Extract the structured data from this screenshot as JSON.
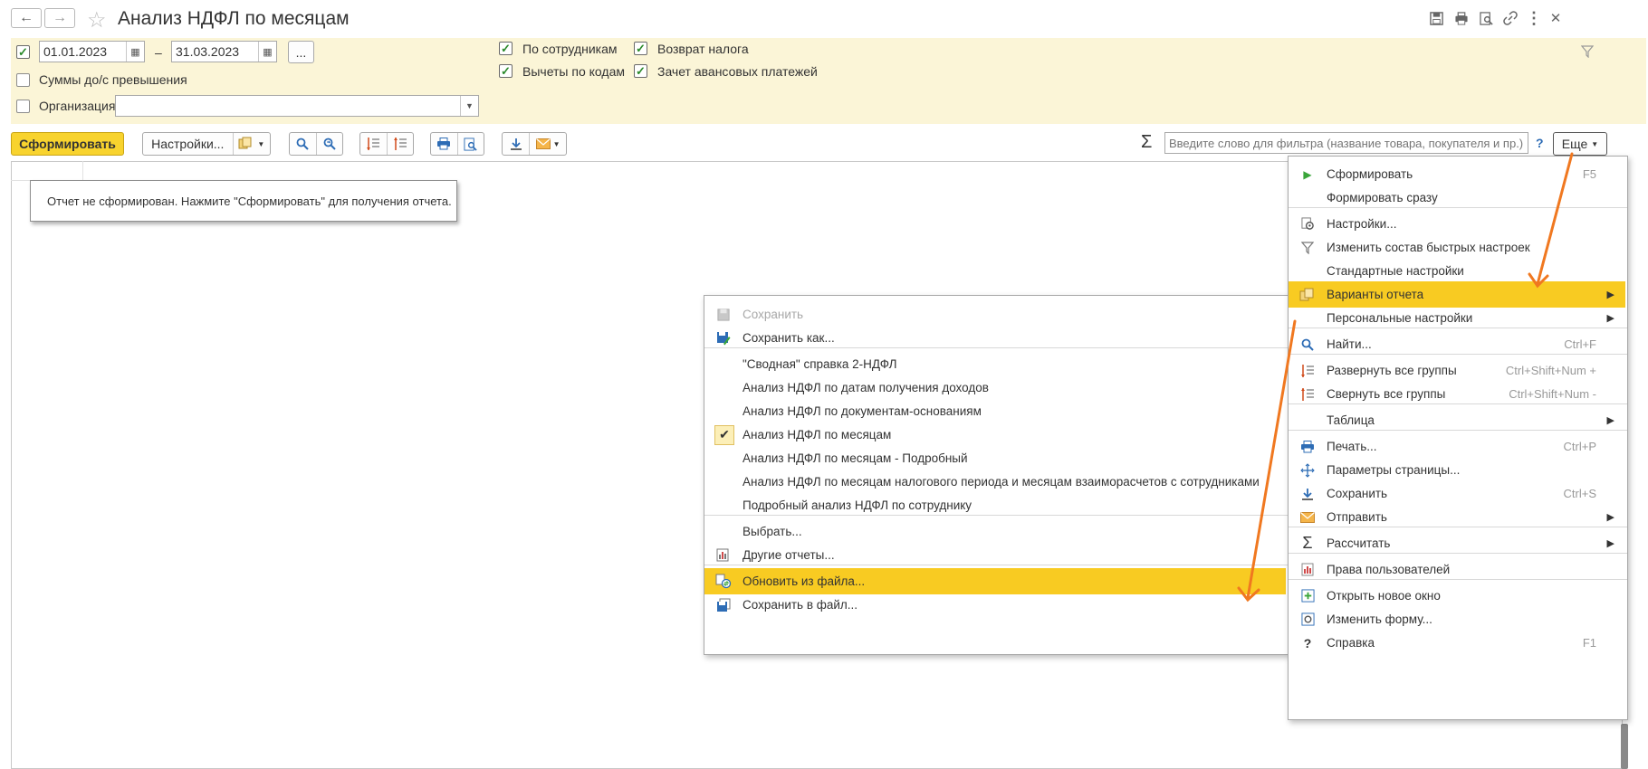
{
  "window": {
    "title": "Анализ НДФЛ по месяцам",
    "icons": [
      "save-icon",
      "print-icon",
      "preview-icon",
      "link-icon",
      "more-vert-icon",
      "close-icon"
    ]
  },
  "filters": {
    "period_enabled": true,
    "date_from": "01.01.2023",
    "date_sep": "–",
    "date_to": "31.03.2023",
    "period_button": "...",
    "sums_label": "Суммы до/с превышения",
    "org_label": "Организация:",
    "org_value": "",
    "by_employees": "По сотрудникам",
    "deductions_by_codes": "Вычеты по кодам",
    "tax_refund": "Возврат налога",
    "advance_offset": "Зачет авансовых платежей"
  },
  "toolbar": {
    "generate": "Сформировать",
    "settings": "Настройки...",
    "search_placeholder": "Введите слово для фильтра (название товара, покупателя и пр.)",
    "help": "?",
    "more": "Еще",
    "sigma": "Σ"
  },
  "report": {
    "notice": "Отчет не сформирован. Нажмите \"Сформировать\" для получения отчета."
  },
  "more_menu": {
    "items": [
      {
        "label": "Сформировать",
        "shortcut": "F5",
        "icon": "play-icon"
      },
      {
        "label": "Формировать сразу",
        "shortcut": ""
      },
      {
        "label": "Настройки...",
        "shortcut": "",
        "icon": "settings-icon"
      },
      {
        "label": "Изменить состав быстрых настроек",
        "shortcut": "",
        "icon": "filter-icon"
      },
      {
        "label": "Стандартные настройки",
        "shortcut": ""
      },
      {
        "label": "Варианты отчета",
        "shortcut": "",
        "icon": "variants-icon",
        "submenu": true,
        "highlighted": true
      },
      {
        "label": "Персональные настройки",
        "shortcut": "",
        "submenu": true
      },
      {
        "label": "Найти...",
        "shortcut": "Ctrl+F",
        "icon": "search-icon"
      },
      {
        "label": "Развернуть все группы",
        "shortcut": "Ctrl+Shift+Num +",
        "icon": "expand-icon"
      },
      {
        "label": "Свернуть все группы",
        "shortcut": "Ctrl+Shift+Num -",
        "icon": "collapse-icon"
      },
      {
        "label": "Таблица",
        "shortcut": "",
        "submenu": true
      },
      {
        "label": "Печать...",
        "shortcut": "Ctrl+P",
        "icon": "print-icon"
      },
      {
        "label": "Параметры страницы...",
        "shortcut": "",
        "icon": "page-setup-icon"
      },
      {
        "label": "Сохранить",
        "shortcut": "Ctrl+S",
        "icon": "download-icon"
      },
      {
        "label": "Отправить",
        "shortcut": "",
        "icon": "mail-icon",
        "submenu": true
      },
      {
        "label": "Рассчитать",
        "shortcut": "",
        "icon": "sigma-icon",
        "submenu": true
      },
      {
        "label": "Права пользователей",
        "shortcut": "",
        "icon": "rights-icon"
      },
      {
        "label": "Открыть новое окно",
        "shortcut": "",
        "icon": "new-window-icon"
      },
      {
        "label": "Изменить форму...",
        "shortcut": "",
        "icon": "form-icon"
      },
      {
        "label": "Справка",
        "shortcut": "F1",
        "icon": "help-icon"
      }
    ]
  },
  "variants_menu": {
    "items": [
      {
        "label": "Сохранить",
        "disabled": true,
        "icon": "save-icon"
      },
      {
        "label": "Сохранить как...",
        "icon": "save-as-icon"
      },
      {
        "label": "\"Сводная\" справка 2-НДФЛ"
      },
      {
        "label": "Анализ НДФЛ по датам получения доходов"
      },
      {
        "label": "Анализ НДФЛ по документам-основаниям"
      },
      {
        "label": "Анализ НДФЛ по месяцам",
        "checked": true
      },
      {
        "label": "Анализ НДФЛ по месяцам - Подробный"
      },
      {
        "label": "Анализ НДФЛ по месяцам налогового периода и месяцам взаиморасчетов с сотрудниками"
      },
      {
        "label": "Подробный анализ НДФЛ по сотруднику"
      },
      {
        "label": "Выбрать..."
      },
      {
        "label": "Другие отчеты...",
        "icon": "reports-icon"
      },
      {
        "label": "Обновить из файла...",
        "icon": "update-file-icon",
        "highlighted": true
      },
      {
        "label": "Сохранить в файл...",
        "icon": "save-file-icon"
      }
    ]
  },
  "colors": {
    "accent_yellow": "#f8d32e",
    "filter_bg": "#fbf5d7",
    "arrow_orange": "#f07820"
  }
}
